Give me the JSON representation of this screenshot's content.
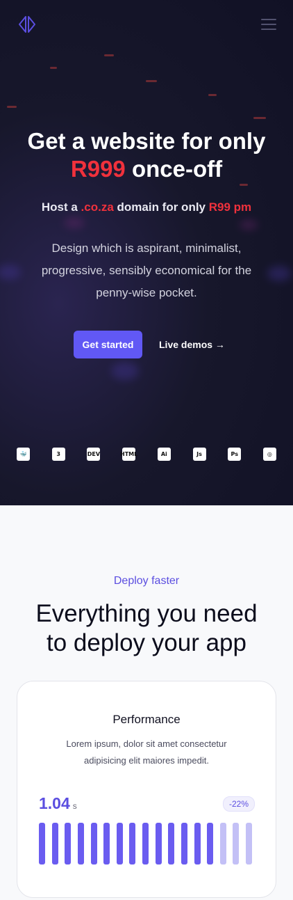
{
  "nav": {
    "logo_icon": "split-diamond-logo",
    "menu_icon": "hamburger-icon"
  },
  "hero": {
    "title_line1": "Get a website for only",
    "title_price": "R999",
    "title_suffix": " once-off",
    "subtitle_prefix": "Host a ",
    "subtitle_domain": ".co.za",
    "subtitle_middle": " domain for only ",
    "subtitle_price": "R99 pm",
    "description": "Design which is aspirant, minimalist, progressive, sensibly economical for the penny-wise pocket.",
    "cta_primary": "Get started",
    "cta_secondary": "Live demos →",
    "accent_color": "#f0313c",
    "brand_color": "#6158f5"
  },
  "tech_icons": [
    {
      "name": "docker-icon",
      "glyph": "🐳"
    },
    {
      "name": "css3-icon",
      "glyph": "3"
    },
    {
      "name": "dev-icon",
      "glyph": "DEV"
    },
    {
      "name": "html-icon",
      "glyph": "HTML"
    },
    {
      "name": "illustrator-icon",
      "glyph": "Ai"
    },
    {
      "name": "javascript-icon",
      "glyph": "Js"
    },
    {
      "name": "photoshop-icon",
      "glyph": "Ps"
    },
    {
      "name": "circle-logo-icon",
      "glyph": "◎"
    }
  ],
  "features": {
    "eyebrow": "Deploy faster",
    "title": "Everything you need to deploy your app",
    "card": {
      "title": "Performance",
      "description": "Lorem ipsum, dolor sit amet consectetur adipisicing elit maiores impedit.",
      "metric_value": "1.04",
      "metric_unit": "s",
      "badge": "-22%",
      "bar_count": 17,
      "active_bars": 14,
      "active_color": "#6a5cf0",
      "inactive_color": "#c3c0f6"
    }
  }
}
